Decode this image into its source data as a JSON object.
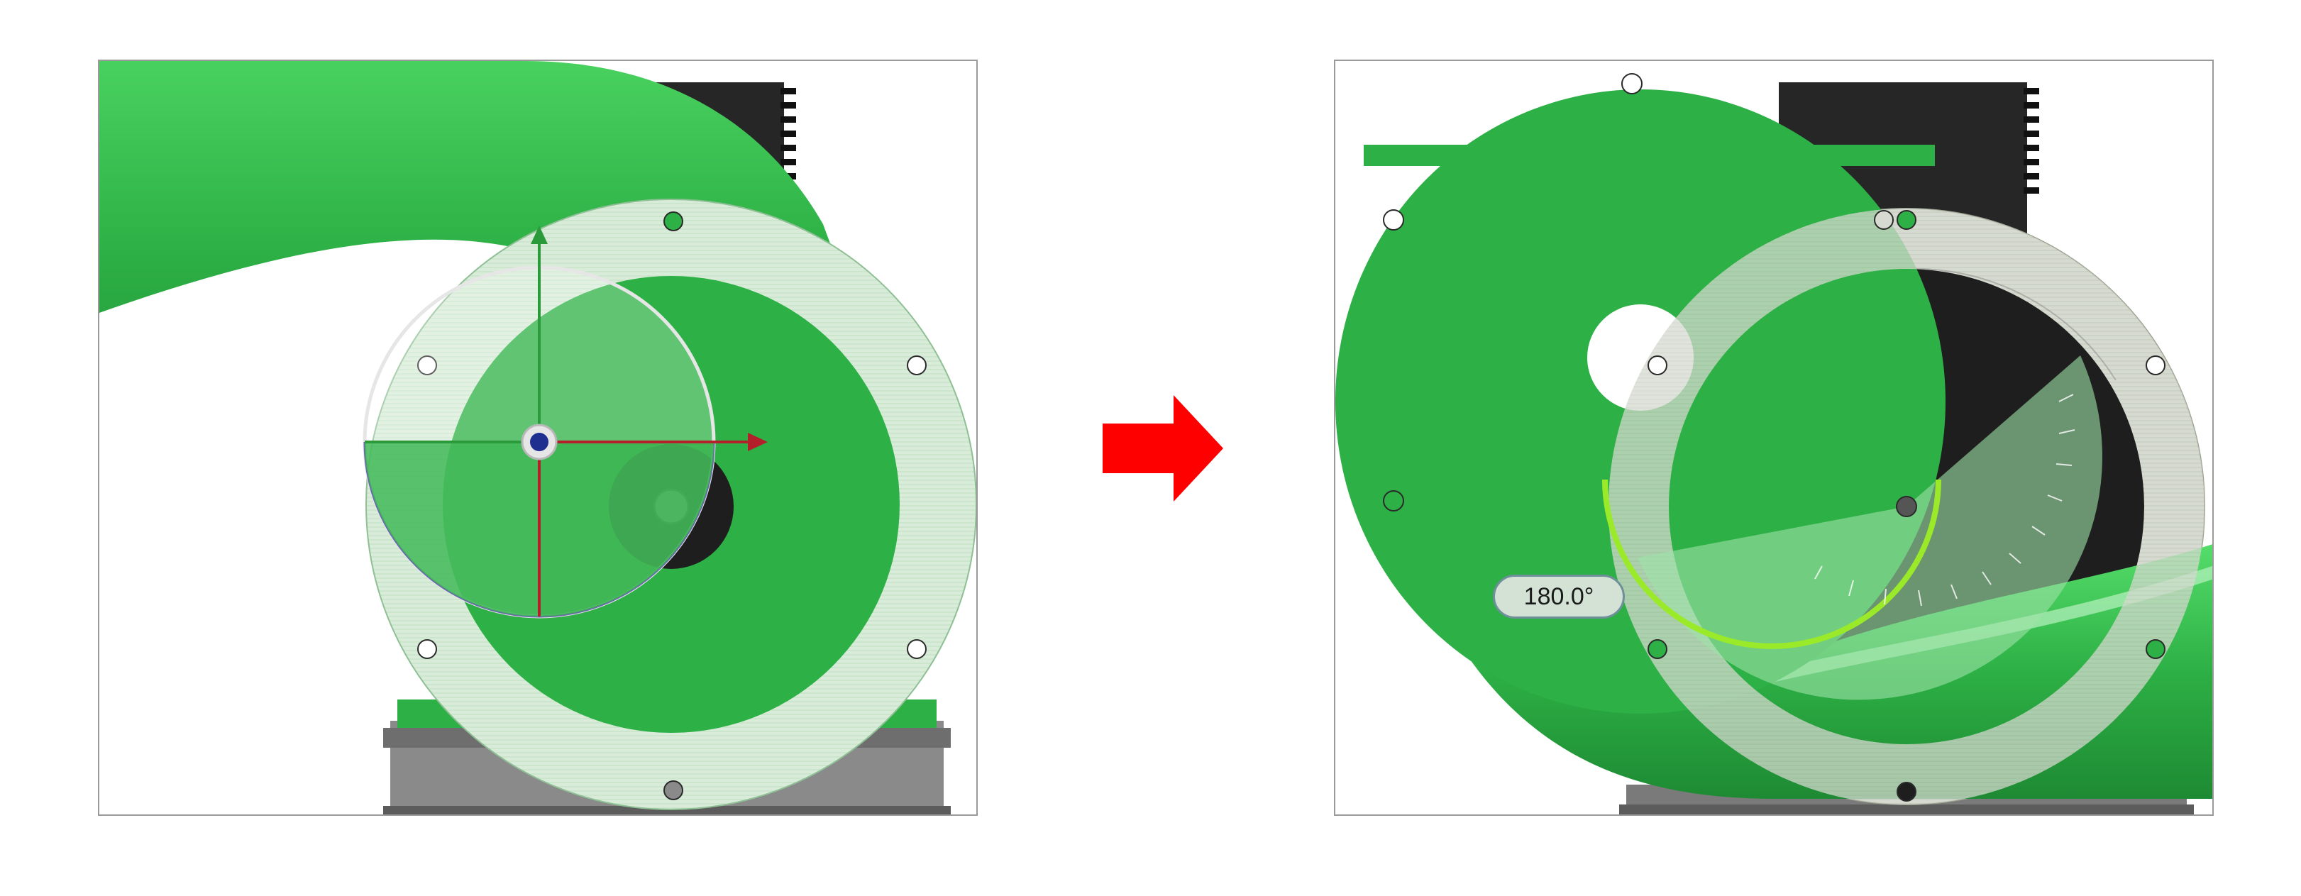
{
  "panels": [
    {
      "name": "before-rotation-view"
    },
    {
      "name": "after-rotation-view"
    }
  ],
  "transition_arrow": {
    "icon": "right-arrow-icon",
    "color": "#ff0000"
  },
  "rotation_readout": {
    "angle_label": "180.0°"
  },
  "colors": {
    "part_green": "#2db045",
    "part_green_light": "#7ed98c",
    "flange_overlay": "#d8ecd9",
    "motor_black": "#1e1e1e",
    "base_gray": "#7a7a7a",
    "axis_x": "#b3202a",
    "axis_y": "#2a9a3a",
    "pivot_blue": "#1f2f8f",
    "protractor_arc": "#9bea2a"
  }
}
